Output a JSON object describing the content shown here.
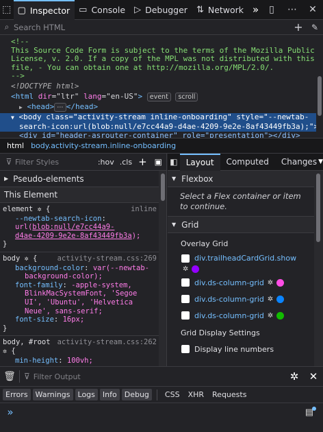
{
  "toolbar": {
    "tabs": [
      {
        "label": "Inspector",
        "icon": "inspector-icon"
      },
      {
        "label": "Console",
        "icon": "console-icon"
      },
      {
        "label": "Debugger",
        "icon": "debugger-icon"
      },
      {
        "label": "Network",
        "icon": "network-icon"
      }
    ],
    "active_tab": "Inspector",
    "more_glyph": "»"
  },
  "search_html": {
    "placeholder": "Search HTML"
  },
  "markup": {
    "comment_lines": [
      "<!--",
      "This Source Code Form is subject to the terms of the Mozilla Public -",
      "License, v. 2.0. If a copy of the MPL was not distributed with this",
      "file, - You can obtain one at http://mozilla.org/MPL/2.0/.",
      "-->"
    ],
    "doctype": "<!DOCTYPE html>",
    "html_open_tag": "<html",
    "html_attr1_name": "dir",
    "html_attr1_value": "\"ltr\"",
    "html_attr2_name": "lang",
    "html_attr2_value": "\"en-US\"",
    "html_close": ">",
    "badge_event": "event",
    "badge_scroll": "scroll",
    "head_open": "<head>",
    "head_ellipsis": "⋯",
    "head_close": "</head>",
    "body_tag": "<body",
    "body_attr1_name": "class",
    "body_attr1_value": "\"activity-stream inline-onboarding\"",
    "body_attr2_name": "style",
    "body_attr2_value_line1": "\"--newtab-",
    "body_attr2_value_line2": "search-icon:url(blob:null/e7cc44a9-d4ae-4209-9e2e-8af43449fb3a);\">",
    "next_line": "<div id=\"header-asrouter-container\" role=\"presentation\"></div>"
  },
  "breadcrumb": [
    "html",
    "body.activity-stream.inline-onboarding"
  ],
  "rules_panel": {
    "filter_placeholder": "Filter Styles",
    "hov": ":hov",
    "cls": ".cls",
    "pseudo_elements": "Pseudo-elements",
    "this_element": "This Element",
    "element_rule": {
      "selector": "element",
      "source": "inline",
      "prop": "--newtab-search-icon",
      "value_fn": "url(",
      "value_link_1": "blob:null/e7cc44a9-",
      "value_link_2": "d4ae-4209-9e2e-8af43449fb3a",
      "value_end": ");"
    },
    "body_rule": {
      "selector": "body",
      "source": "activity-stream.css:269",
      "declarations": [
        {
          "name": "background-color",
          "value_lines": [
            "var(--newtab-",
            "background-color);"
          ]
        },
        {
          "name": "font-family",
          "value_lines": [
            "-apple-system,",
            "BlinkMacSystemFont, 'Segoe",
            "UI', 'Ubuntu', 'Helvetica",
            "Neue', sans-serif;"
          ]
        },
        {
          "name": "font-size",
          "value_lines": [
            "16px;"
          ]
        }
      ]
    },
    "root_rule": {
      "selector": "body, #root",
      "source": "activity-stream.css:262",
      "declarations": [
        {
          "name": "min-height",
          "value": "100vh;"
        }
      ]
    }
  },
  "layout_panel": {
    "tabs": [
      "Layout",
      "Computed",
      "Changes"
    ],
    "active_tab": "Layout",
    "flexbox_title": "Flexbox",
    "flexbox_message": "Select a Flex container or item to continue.",
    "grid_title": "Grid",
    "overlay_grid_title": "Overlay Grid",
    "grids": [
      {
        "name": "div.trailheadCardGrid.show",
        "color": "#9400ff"
      },
      {
        "name": "div.ds-column-grid",
        "color": "#ff4de5"
      },
      {
        "name": "div.ds-column-grid",
        "color": "#0a84ff"
      },
      {
        "name": "div.ds-column-grid",
        "color": "#12bc00"
      }
    ],
    "display_settings_title": "Grid Display Settings",
    "display_line_numbers": "Display line numbers"
  },
  "console": {
    "filter_placeholder": "Filter Output",
    "filter_buttons": [
      "Errors",
      "Warnings",
      "Logs",
      "Info",
      "Debug"
    ],
    "plain_filters": [
      "CSS",
      "XHR",
      "Requests"
    ],
    "prompt": "»"
  }
}
